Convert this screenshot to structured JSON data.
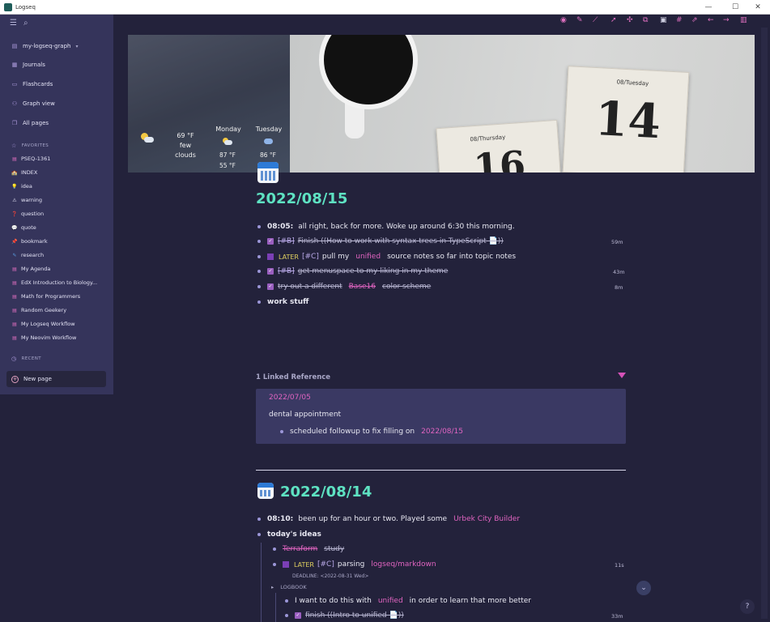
{
  "window": {
    "title": "Logseq",
    "controls": [
      "—",
      "☐",
      "✕"
    ]
  },
  "sidebar": {
    "graph_name": "my-logseq-graph",
    "nav": [
      "Journals",
      "Flashcards",
      "Graph view",
      "All pages"
    ],
    "favorites_label": "FAVORITES",
    "favorites": [
      "PSEQ-1361",
      "INDEX",
      "idea",
      "warning",
      "question",
      "quote",
      "bookmark",
      "research",
      "My Agenda",
      "EdX Introduction to Biology...",
      "Math for Programmers",
      "Random Geekery",
      "My Logseq Workflow",
      "My Neovim Workflow"
    ],
    "recent_label": "RECENT",
    "new_page": "New page"
  },
  "weather": {
    "now_temp": "69 °F",
    "now_desc_1": "few",
    "now_desc_2": "clouds",
    "day1": "Monday",
    "day1_hi": "87 °F",
    "day1_lo": "55 °F",
    "day2": "Tuesday",
    "day2_hi": "86 °F"
  },
  "hero": {
    "cal1_head": "08/Thursday",
    "cal1_num": "16",
    "cal2_head": "08/Tuesday",
    "cal2_num": "14"
  },
  "journal1": {
    "title": "2022/08/15",
    "b1_time": "08:05:",
    "b1_text": "all right, back for more. Woke up around 6:30 this morning.",
    "b2_tag": "[#B]",
    "b2_text": "Finish ((How to work with syntax trees in TypeScript 📄))",
    "b2_time": "59m",
    "b3_later": "LATER",
    "b3_tag": "[#C]",
    "b3_pre": "pull my",
    "b3_ref": "unified",
    "b3_post": "source notes so far into topic notes",
    "b4_tag": "[#B]",
    "b4_text": "get menuspace to my liking in my theme",
    "b4_time": "43m",
    "b5_pre": "try out a different",
    "b5_ref": "Base16",
    "b5_post": "color scheme",
    "b5_time": "8m",
    "b6": "work stuff"
  },
  "linked": {
    "header": "1 Linked Reference",
    "date": "2022/07/05",
    "title": "dental appointment",
    "child_pre": "scheduled followup to fix filling on",
    "child_ref": "2022/08/15"
  },
  "journal2": {
    "title": "2022/08/14",
    "b1_time": "08:10:",
    "b1_pre": "been up for an hour or two. Played some",
    "b1_ref": "Urbek City Builder",
    "b2": "today's ideas",
    "b3_ref": "Terraform",
    "b3_post": "study",
    "b4_later": "LATER",
    "b4_tag": "[#C]",
    "b4_pre": "parsing",
    "b4_ref": "logseq/markdown",
    "b4_time": "11s",
    "deadline": "DEADLINE: <2022-08-31 Wed>",
    "logbook": "LOGBOOK",
    "b5_pre": "I want to do this with",
    "b5_ref": "unified",
    "b5_post": "in order to learn that more better",
    "b6_text": "finish ((Intro to unified 📄))",
    "b6_time": "33m"
  },
  "fab_help": "?",
  "fab_down": "⌄",
  "colors": {
    "accent": "#5ee2c2",
    "ref": "#e064c0",
    "sidebar_bg": "#35345b",
    "main_bg": "#23223b"
  }
}
